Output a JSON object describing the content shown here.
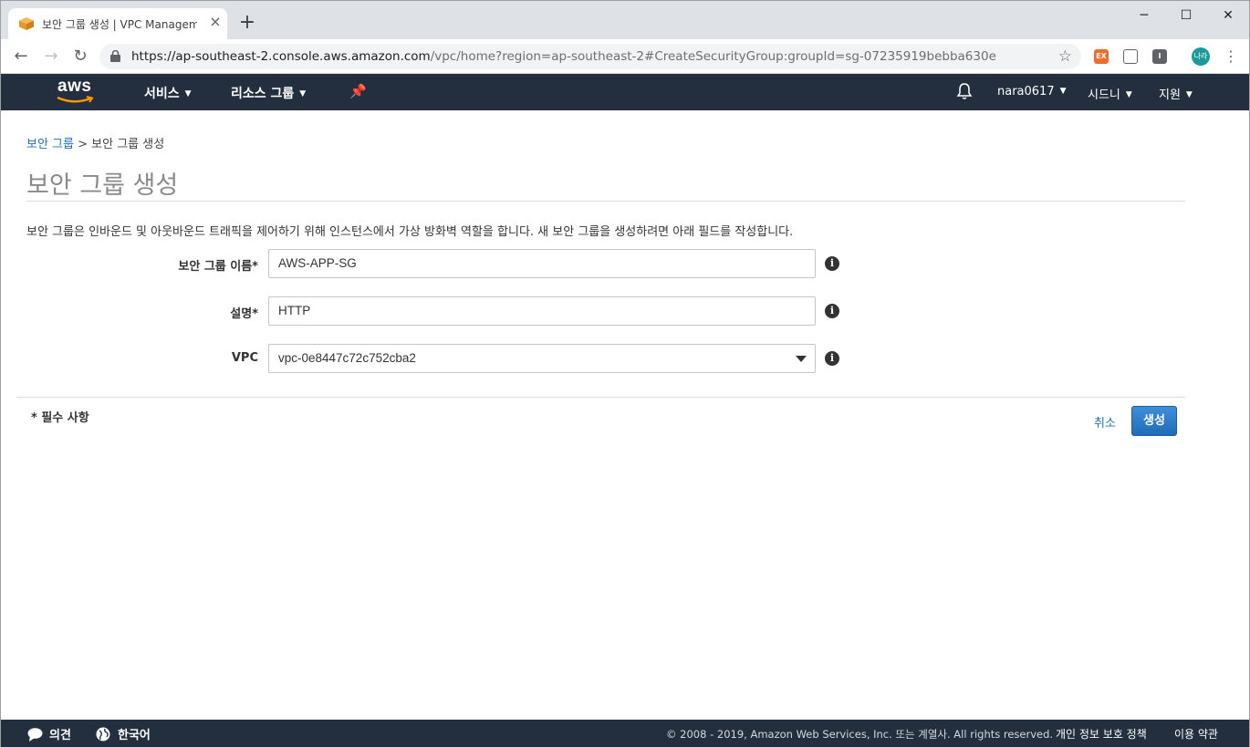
{
  "browser": {
    "tab_title": "보안 그룹 생성 | VPC Managem",
    "url_host": "https://ap-southeast-2.console.aws.amazon.com",
    "url_path": "/vpc/home?region=ap-southeast-2#CreateSecurityGroup:groupId=sg-07235919bebba630e",
    "extensions": [
      "EX",
      "",
      "I"
    ],
    "profile_label": "나라"
  },
  "aws_nav": {
    "logo": "aws",
    "services": "서비스",
    "resource_groups": "리소스 그룹",
    "user": "nara0617",
    "region": "시드니",
    "support": "지원"
  },
  "breadcrumb": {
    "parent": "보안 그룹",
    "separator": ">",
    "current": "보안 그룹 생성"
  },
  "page": {
    "title": "보안 그룹 생성",
    "description": "보안 그룹은 인바운드 및 아웃바운드 트래픽을 제어하기 위해 인스턴스에서 가상 방화벽 역할을 합니다. 새 보안 그룹을 생성하려면 아래 필드를 작성합니다."
  },
  "form": {
    "name_label": "보안 그룹 이름*",
    "name_value": "AWS-APP-SG",
    "description_label": "설명*",
    "description_value": "HTTP",
    "vpc_label": "VPC",
    "vpc_value": "vpc-0e8447c72c752cba2",
    "info_glyph": "i",
    "required_note": "* 필수 사항",
    "cancel_label": "취소",
    "create_label": "생성"
  },
  "footer": {
    "feedback": "의견",
    "language": "한국어",
    "copyright": "© 2008 - 2019, Amazon Web Services, Inc. 또는 계열사. All rights reserved.",
    "privacy": "개인 정보 보호 정책",
    "terms": "이용 약관"
  },
  "colors": {
    "aws_nav_bg": "#232f3e",
    "link_blue": "#1e6fc4",
    "primary_button": "#1f6bb8",
    "aws_orange": "#ff9900"
  }
}
